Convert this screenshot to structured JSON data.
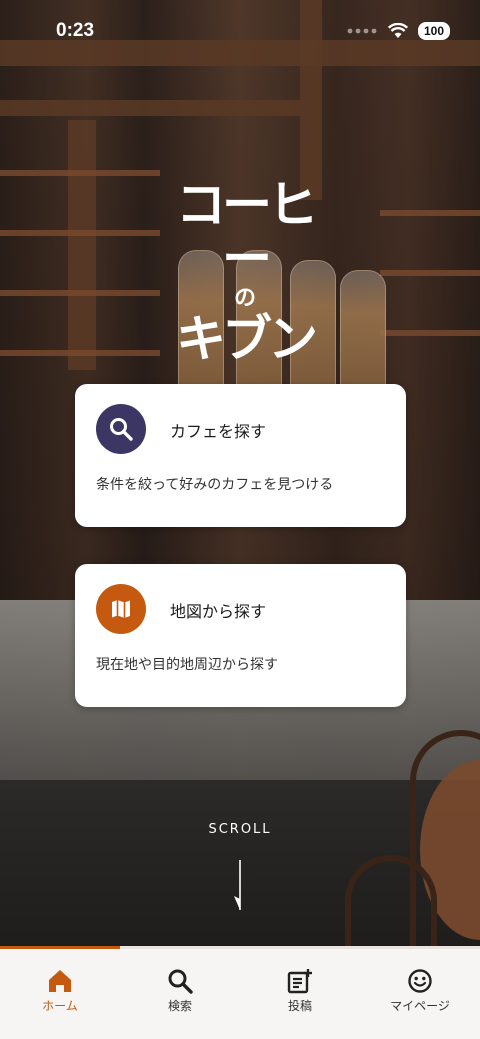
{
  "status_bar": {
    "time": "0:23",
    "battery": "100"
  },
  "logo": {
    "line1": "コーヒー",
    "line2": "の",
    "line3": "キブン"
  },
  "cards": [
    {
      "title": "カフェを探す",
      "description": "条件を絞って好みのカフェを見つける",
      "icon": "search-icon",
      "icon_color": "#3b3664"
    },
    {
      "title": "地図から探す",
      "description": "現在地や目的地周辺から探す",
      "icon": "map-icon",
      "icon_color": "#c4590f"
    }
  ],
  "scroll_hint": "SCROLL",
  "bottom_nav": {
    "scroll_progress": 0.25,
    "items": [
      {
        "label": "ホーム",
        "icon": "home-icon",
        "active": true
      },
      {
        "label": "検索",
        "icon": "search-icon",
        "active": false
      },
      {
        "label": "投稿",
        "icon": "post-icon",
        "active": false
      },
      {
        "label": "マイページ",
        "icon": "smiley-icon",
        "active": false
      }
    ]
  },
  "colors": {
    "accent": "#c4590f",
    "search_icon_bg": "#3b3664",
    "nav_bg": "#f6f5f4"
  }
}
